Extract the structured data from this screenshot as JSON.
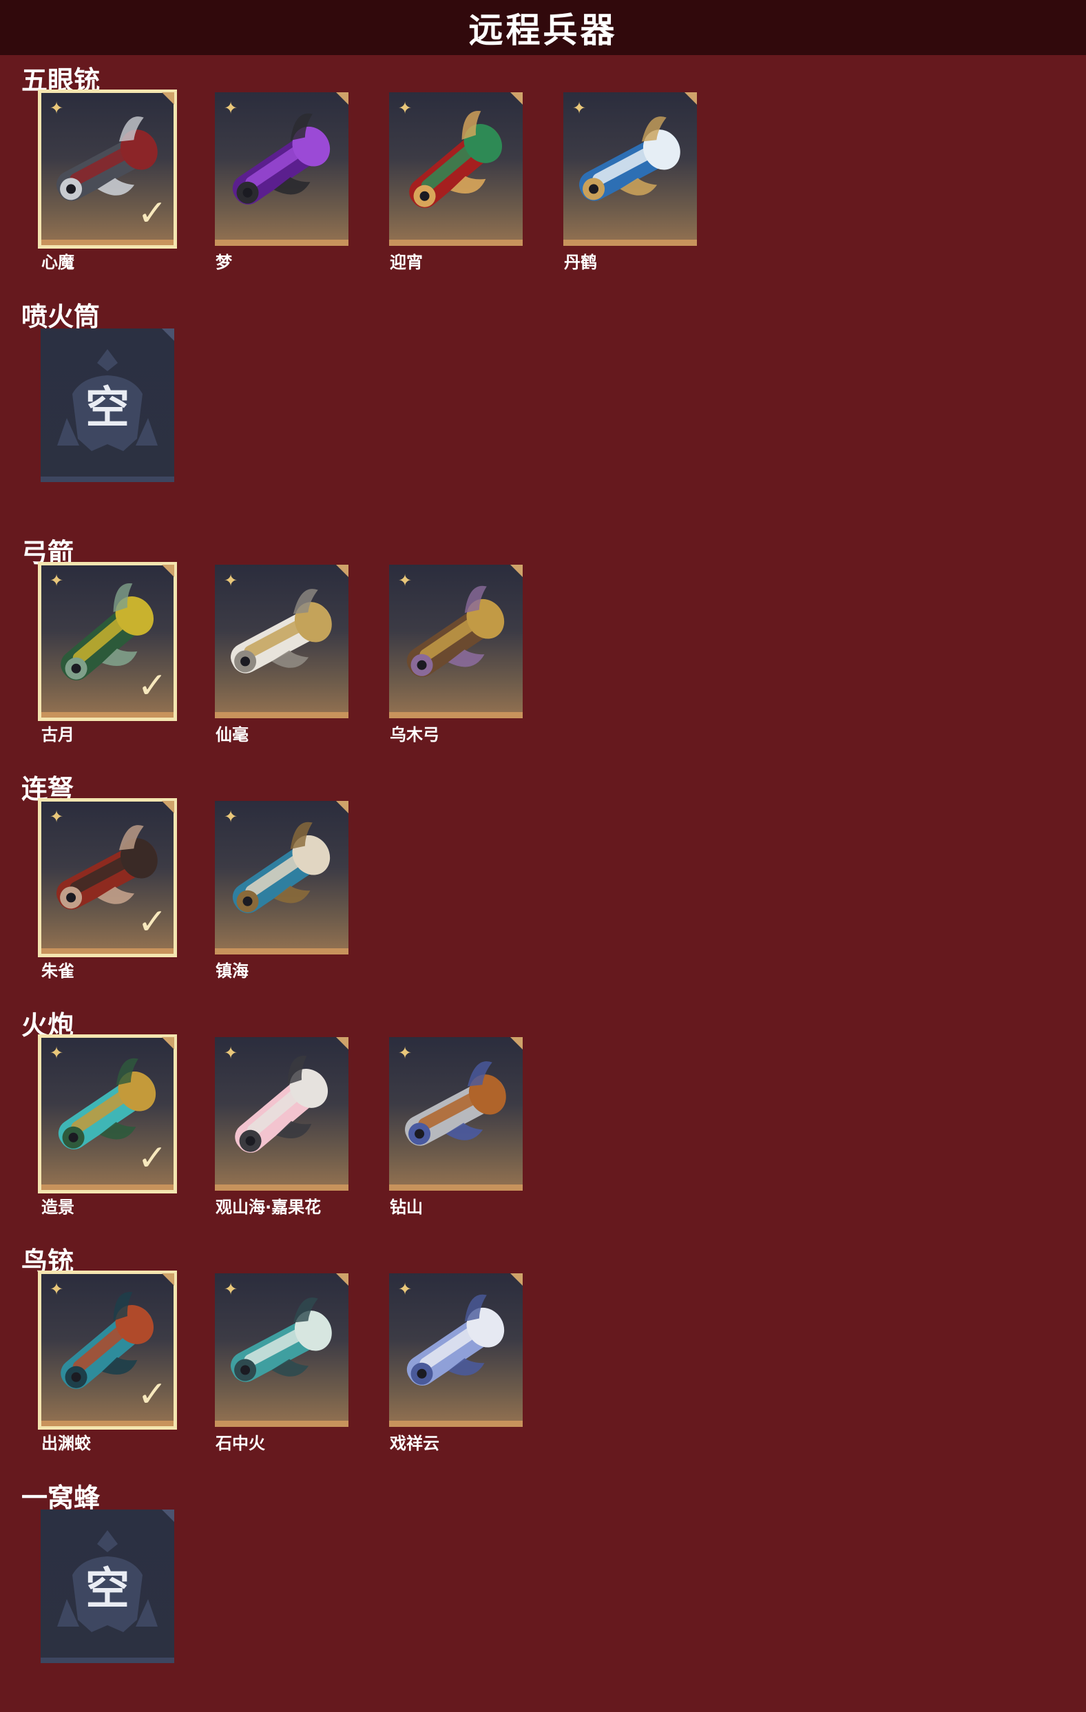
{
  "page": {
    "title": "远程兵器"
  },
  "colors": {
    "background": "#66191e",
    "title_bar": "#31090c",
    "card_bottom": "#c8935c",
    "selected_border": "#f4e5b0",
    "empty_card": "#2c3141",
    "star": "#e9c77a"
  },
  "sections": [
    {
      "title": "五眼铳",
      "items": [
        {
          "name": "心魔",
          "selected": true,
          "icon": "dark-crimson-multi-barrel-gun",
          "palette": [
            "#4a4d57",
            "#8c2528",
            "#c8cbd0"
          ]
        },
        {
          "name": "梦",
          "selected": false,
          "icon": "purple-feathered-multi-barrel-gun",
          "palette": [
            "#5b1f8e",
            "#9b4ad6",
            "#2a2a2f"
          ]
        },
        {
          "name": "迎宵",
          "selected": false,
          "icon": "red-lion-multi-barrel-gun",
          "palette": [
            "#a51f1f",
            "#2e8a55",
            "#d9a65a"
          ]
        },
        {
          "name": "丹鹤",
          "selected": false,
          "icon": "blue-crane-multi-barrel-gun",
          "palette": [
            "#2d6fb4",
            "#e6eef5",
            "#c9a15a"
          ]
        }
      ]
    },
    {
      "title": "喷火筒",
      "items": [
        {
          "name": "",
          "empty": true,
          "empty_text": "空",
          "icon": "empty-slot-emblem"
        }
      ]
    },
    {
      "title": "弓箭",
      "items": [
        {
          "name": "古月",
          "selected": true,
          "icon": "green-dragon-bow",
          "palette": [
            "#2c5a3a",
            "#c9b22e",
            "#7fa08a"
          ]
        },
        {
          "name": "仙毫",
          "selected": false,
          "icon": "white-feather-bow",
          "palette": [
            "#e8e4dc",
            "#c4a35a",
            "#8f8a82"
          ]
        },
        {
          "name": "乌木弓",
          "selected": false,
          "icon": "ebony-wood-bow",
          "palette": [
            "#6b4a2f",
            "#c29a45",
            "#8a6a9a"
          ]
        }
      ]
    },
    {
      "title": "连弩",
      "items": [
        {
          "name": "朱雀",
          "selected": true,
          "icon": "crimson-bird-crossbow",
          "palette": [
            "#8e2a1f",
            "#3a2a26",
            "#c2a08a"
          ]
        },
        {
          "name": "镇海",
          "selected": false,
          "icon": "sea-guardian-crossbow",
          "palette": [
            "#2f7fa0",
            "#e1d6c2",
            "#8a6a3a"
          ]
        }
      ]
    },
    {
      "title": "火炮",
      "items": [
        {
          "name": "造景",
          "selected": true,
          "icon": "turquoise-hand-cannon",
          "palette": [
            "#3fb6b6",
            "#c49a3a",
            "#2e5a3c"
          ]
        },
        {
          "name": "观山海·嘉果花",
          "selected": false,
          "icon": "pink-blossom-hand-cannon",
          "palette": [
            "#f3c4cf",
            "#e6e2de",
            "#3a3a3f"
          ]
        },
        {
          "name": "钻山",
          "selected": false,
          "icon": "silver-drill-hand-cannon",
          "palette": [
            "#b7b9be",
            "#b0642a",
            "#4a5aa0"
          ]
        }
      ]
    },
    {
      "title": "鸟铳",
      "items": [
        {
          "name": "出渊蛟",
          "selected": true,
          "icon": "dragon-scale-musket",
          "palette": [
            "#2e8c9c",
            "#b04a2a",
            "#1d3f4a"
          ]
        },
        {
          "name": "石中火",
          "selected": false,
          "icon": "teal-flame-musket",
          "palette": [
            "#3f9fa0",
            "#d7e6e0",
            "#2e4a4f"
          ]
        },
        {
          "name": "戏祥云",
          "selected": false,
          "icon": "silver-cloud-musket",
          "palette": [
            "#8fa0d8",
            "#e6e9f2",
            "#4a5a9a"
          ]
        }
      ]
    },
    {
      "title": "一窝蜂",
      "items": [
        {
          "name": "",
          "empty": true,
          "empty_text": "空",
          "icon": "empty-slot-emblem"
        }
      ]
    }
  ]
}
